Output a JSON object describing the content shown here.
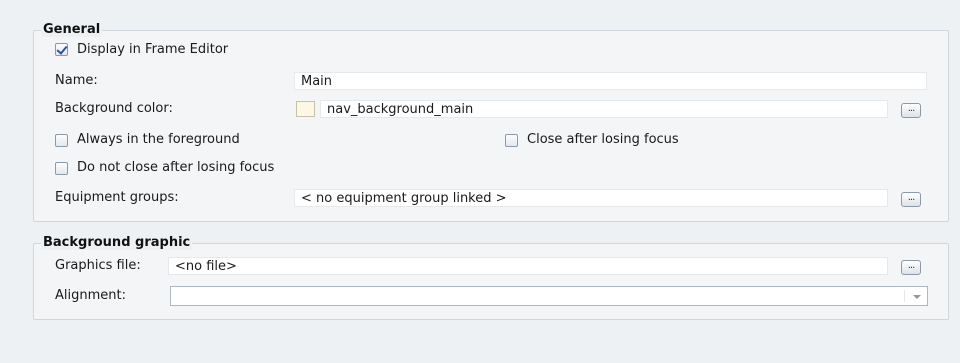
{
  "general": {
    "title": "General",
    "display_in_frame_editor": {
      "label": "Display in Frame Editor",
      "checked": true
    },
    "name": {
      "label": "Name:",
      "value": "Main"
    },
    "background_color": {
      "label": "Background color:",
      "value": "nav_background_main",
      "swatch": "#fdf8e6",
      "button": "..."
    },
    "always_foreground": {
      "label": "Always in the foreground",
      "checked": false
    },
    "close_after_losing_focus": {
      "label": "Close after losing focus",
      "checked": false
    },
    "do_not_close": {
      "label": "Do not close after losing focus",
      "checked": false
    },
    "equipment_groups": {
      "label": "Equipment groups:",
      "value": "< no equipment group linked >",
      "button": "..."
    }
  },
  "background_graphic": {
    "title": "Background graphic",
    "graphics_file": {
      "label": "Graphics file:",
      "value": "<no file>",
      "button": "..."
    },
    "alignment": {
      "label": "Alignment:",
      "value": ""
    }
  }
}
